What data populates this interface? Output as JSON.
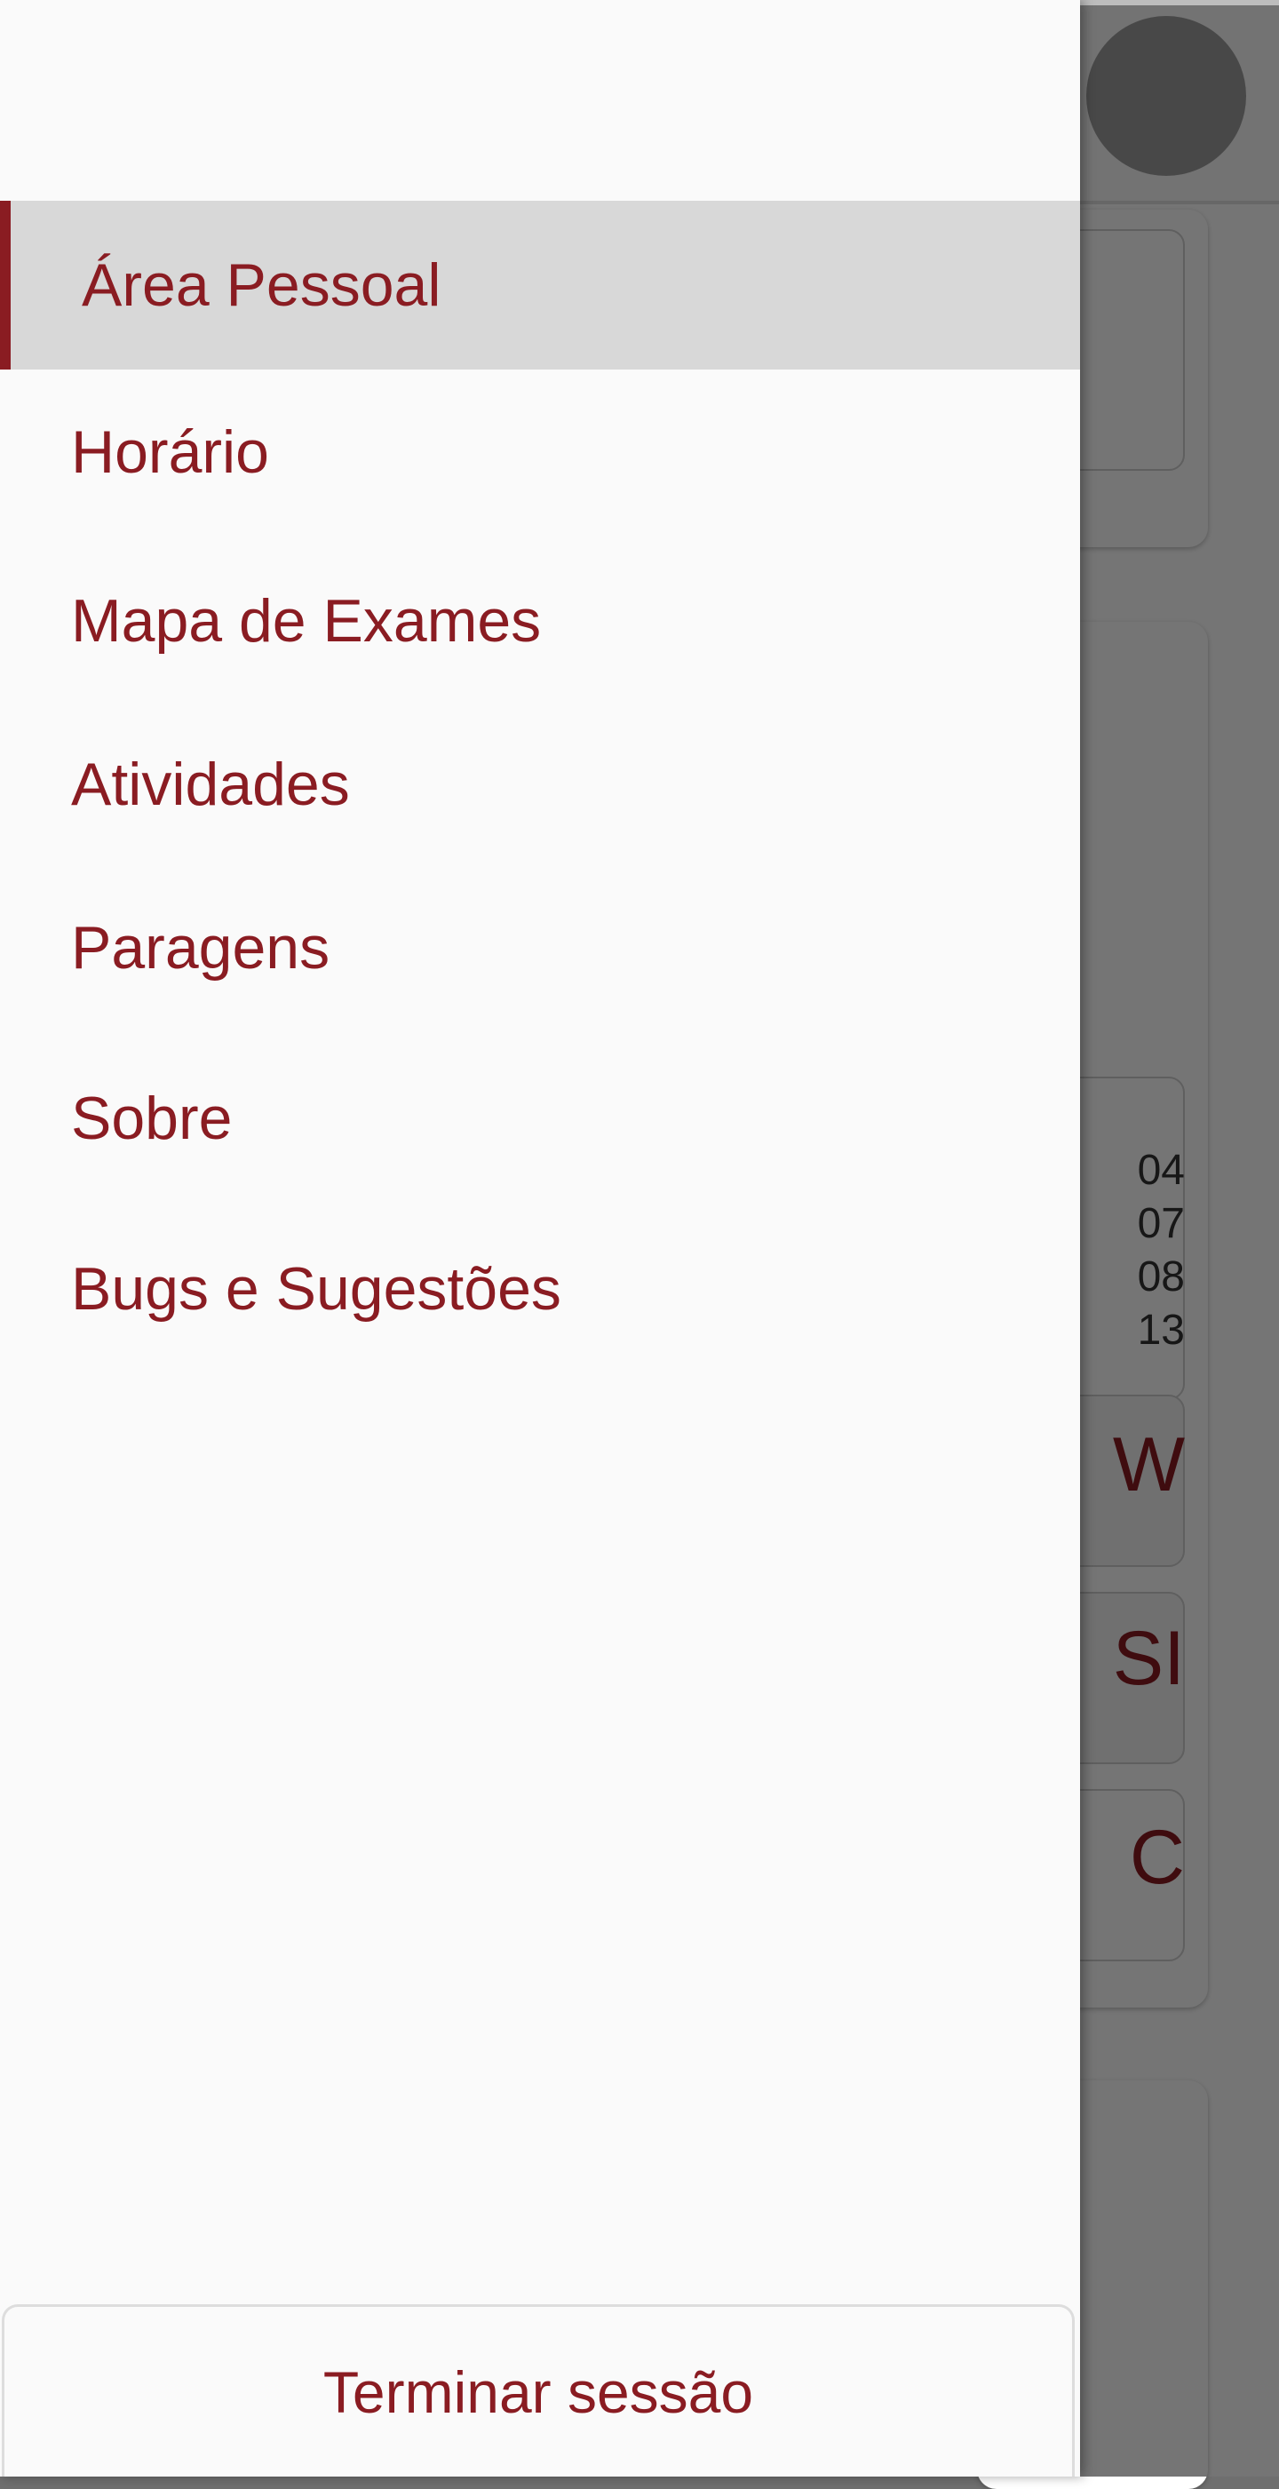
{
  "app": {
    "profile_avatar": "avatar"
  },
  "drawer": {
    "items": [
      {
        "label": "Área Pessoal",
        "selected": true
      },
      {
        "label": "Horário",
        "selected": false
      },
      {
        "label": "Mapa de Exames",
        "selected": false
      },
      {
        "label": "Atividades",
        "selected": false
      },
      {
        "label": "Paragens",
        "selected": false
      },
      {
        "label": "Sobre",
        "selected": false
      },
      {
        "label": "Bugs e Sugestões",
        "selected": false
      }
    ],
    "logout_label": "Terminar sessão"
  },
  "background": {
    "dates": [
      "04",
      "07",
      "08",
      "13"
    ],
    "course_letters": [
      "W",
      "SI",
      "C"
    ]
  },
  "colors": {
    "accent": "#8a1c22",
    "drawer_bg": "#fafafa",
    "selected_bg": "#d8d8d8",
    "scrim": "rgba(0,0,0,0.54)"
  }
}
